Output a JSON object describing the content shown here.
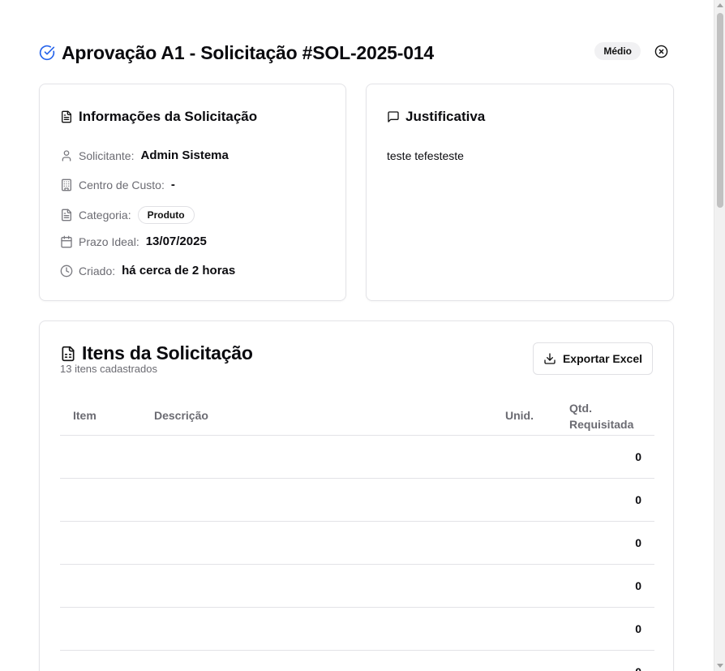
{
  "dialog": {
    "title": "Aprovação A1 - Solicitação #SOL-2025-014",
    "priority": "Médio",
    "title_icon": "circle-check-icon",
    "close_icon": "close-icon"
  },
  "info": {
    "title": "Informações da Solicitação",
    "rows": [
      {
        "icon": "user-icon",
        "label": "Solicitante:",
        "value": "Admin Sistema"
      },
      {
        "icon": "building-icon",
        "label": "Centro de Custo:",
        "value": "-"
      },
      {
        "icon": "file-text-icon",
        "label": "Categoria:",
        "value": "Produto"
      },
      {
        "icon": "calendar-icon",
        "label": "Prazo Ideal:",
        "value": "13/07/2025"
      },
      {
        "icon": "clock-icon",
        "label": "Criado:",
        "value": "há cerca de 2 horas"
      }
    ]
  },
  "justification": {
    "title": "Justificativa",
    "text": "teste tefesteste"
  },
  "items": {
    "title": "Itens da Solicitação",
    "subtitle": "13 itens cadastrados",
    "export_label": "Exportar Excel",
    "columns": {
      "item": "Item",
      "description": "Descrição",
      "unit": "Unid.",
      "qty_line1": "Qtd.",
      "qty_line2": "Requisitada"
    },
    "rows": [
      {
        "item": "",
        "description": "",
        "unit": "",
        "qty": "0"
      },
      {
        "item": "",
        "description": "",
        "unit": "",
        "qty": "0"
      },
      {
        "item": "",
        "description": "",
        "unit": "",
        "qty": "0"
      },
      {
        "item": "",
        "description": "",
        "unit": "",
        "qty": "0"
      },
      {
        "item": "",
        "description": "",
        "unit": "",
        "qty": "0"
      },
      {
        "item": "",
        "description": "",
        "unit": "",
        "qty": "0"
      }
    ]
  },
  "colors": {
    "accent": "#2563eb",
    "border": "#e3e3e7",
    "muted_text": "#6b6b72"
  }
}
